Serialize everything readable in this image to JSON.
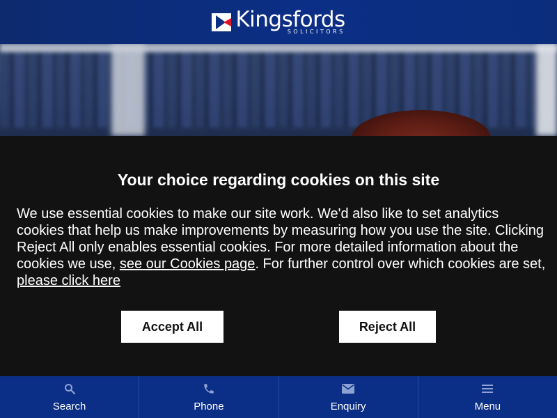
{
  "header": {
    "logo_name": "Kingsfords",
    "logo_sub": "SOLICITORS",
    "brand_color": "#0b2f86",
    "accent_color": "#e0142b"
  },
  "cookie_banner": {
    "title": "Your choice regarding cookies on this site",
    "body_part1": "We use essential cookies to make our site work. We'd also like to set analytics cookies that help us make improvements by measuring how you use the site. Clicking Reject All only enables essential cookies. For more detailed information about the cookies we use, ",
    "link_cookies_page": "see our Cookies page",
    "body_part2": ". For further control over which cookies are set, ",
    "link_click_here": "please click here",
    "accept_label": "Accept All",
    "reject_label": "Reject All"
  },
  "bottom_nav": {
    "items": [
      {
        "label": "Search",
        "icon": "search-icon"
      },
      {
        "label": "Phone",
        "icon": "phone-icon"
      },
      {
        "label": "Enquiry",
        "icon": "mail-icon"
      },
      {
        "label": "Menu",
        "icon": "menu-icon"
      }
    ]
  }
}
